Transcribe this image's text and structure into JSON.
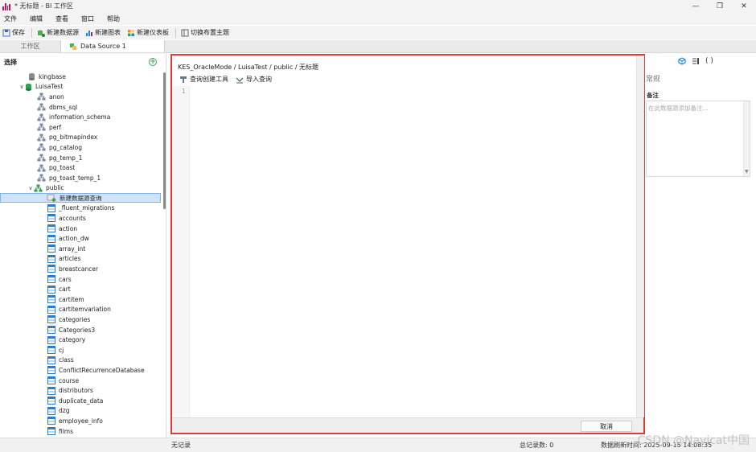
{
  "window": {
    "title": "* 无标题 - BI 工作区"
  },
  "menu": {
    "items": [
      "文件",
      "编辑",
      "查看",
      "窗口",
      "帮助"
    ]
  },
  "toolbar": {
    "save": "保存",
    "new_datasource": "新建数据源",
    "new_chart": "新建图表",
    "new_dashboard": "新建仪表板",
    "switch_layout": "切换布置主题"
  },
  "tabs": {
    "workspace": "工作区",
    "active": "Data Source 1"
  },
  "left": {
    "header": "选择",
    "connections": [
      {
        "label": "kingbase"
      },
      {
        "label": "LuisaTest"
      }
    ],
    "schemas": [
      "anon",
      "dbms_sql",
      "information_schema",
      "perf",
      "pg_bitmapindex",
      "pg_catalog",
      "pg_temp_1",
      "pg_toast",
      "pg_toast_temp_1",
      "public"
    ],
    "new_query": "新建数据源查询",
    "tables": [
      "_fluent_migrations",
      "accounts",
      "action",
      "action_dw",
      "array_int",
      "articles",
      "breastcancer",
      "cars",
      "cart",
      "cartitem",
      "cartitemvariation",
      "categories",
      "Categories3",
      "category",
      "cj",
      "class",
      "ConflictRecurrenceDatabase",
      "course",
      "distributors",
      "duplicate_data",
      "dzg",
      "employee_info",
      "films"
    ]
  },
  "editor": {
    "breadcrumb": "KES_OracleMode / LuisaTest / public / 无标题",
    "query_builder": "查询创建工具",
    "import_query": "导入查询",
    "line_number": "1",
    "cancel": "取消"
  },
  "right": {
    "section": "常规",
    "notes_label": "备注",
    "notes_placeholder": "在此数据源添加备注..."
  },
  "status": {
    "left": "无记录",
    "total": "总记录数: 0",
    "refresh": "数据刷新时间: 2025-09-15 14:08:35"
  },
  "watermark": "CSDN @Navicat中国"
}
